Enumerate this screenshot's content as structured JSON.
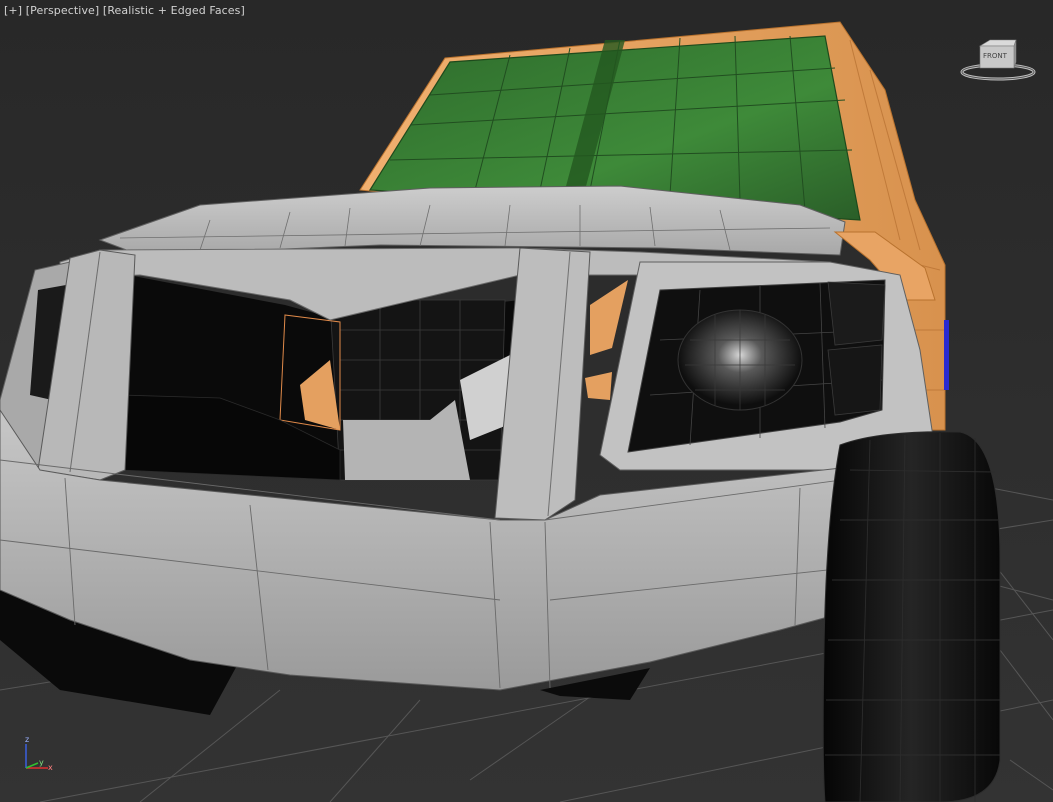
{
  "viewport": {
    "label_parts": [
      "[+]",
      "[Perspective]",
      "[Realistic + Edged Faces]"
    ]
  },
  "viewcube": {
    "face_label": "FRONT"
  },
  "axis": {
    "x": "x",
    "y": "y",
    "z": "z"
  },
  "colors": {
    "background": "#2a2a2a",
    "grid": "#5a5a5a",
    "body_gray": "#b4b4b4",
    "selection_orange": "#e4a060",
    "windshield_green": "#3a7a34",
    "tire_black": "#101010"
  }
}
